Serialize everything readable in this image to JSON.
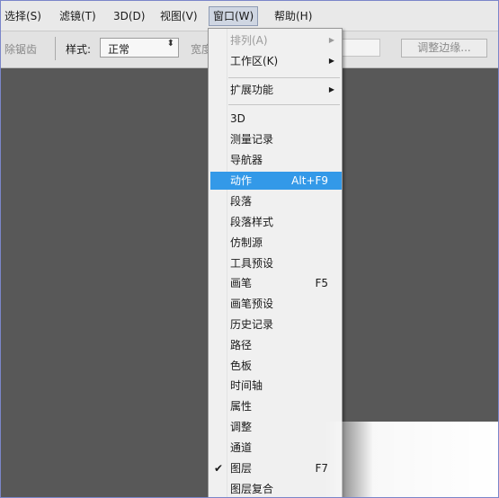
{
  "menubar": {
    "items": [
      {
        "label": "选择(S)"
      },
      {
        "label": "滤镜(T)"
      },
      {
        "label": "3D(D)"
      },
      {
        "label": "视图(V)"
      },
      {
        "label": "窗口(W)",
        "active": true
      },
      {
        "label": "帮助(H)"
      }
    ]
  },
  "options_bar": {
    "partial_left": "除锯齿",
    "style_label": "样式:",
    "style_value": "正常",
    "width_label_partial": "宽度",
    "refine_edge_button": "调整边缘..."
  },
  "window_menu": {
    "items": [
      {
        "label": "排列(A)",
        "disabled": true,
        "submenu": true
      },
      {
        "label": "工作区(K)",
        "submenu": true
      },
      {
        "label": "扩展功能",
        "submenu": true
      },
      {
        "label": "3D"
      },
      {
        "label": "测量记录"
      },
      {
        "label": "导航器"
      },
      {
        "label": "动作",
        "shortcut": "Alt+F9",
        "highlighted": true
      },
      {
        "label": "段落"
      },
      {
        "label": "段落样式"
      },
      {
        "label": "仿制源"
      },
      {
        "label": "工具预设"
      },
      {
        "label": "画笔",
        "shortcut": "F5"
      },
      {
        "label": "画笔预设"
      },
      {
        "label": "历史记录"
      },
      {
        "label": "路径"
      },
      {
        "label": "色板"
      },
      {
        "label": "时间轴"
      },
      {
        "label": "属性"
      },
      {
        "label": "调整"
      },
      {
        "label": "通道"
      },
      {
        "label": "图层",
        "shortcut": "F7",
        "checked": true
      },
      {
        "label": "图层复合"
      }
    ]
  },
  "icons": {
    "submenu_arrow": "▶",
    "check": "✔",
    "select_arrows": "⬍"
  },
  "colors": {
    "highlight": "#3399e8",
    "canvas": "#585858",
    "menubar": "#e9e9e9"
  }
}
